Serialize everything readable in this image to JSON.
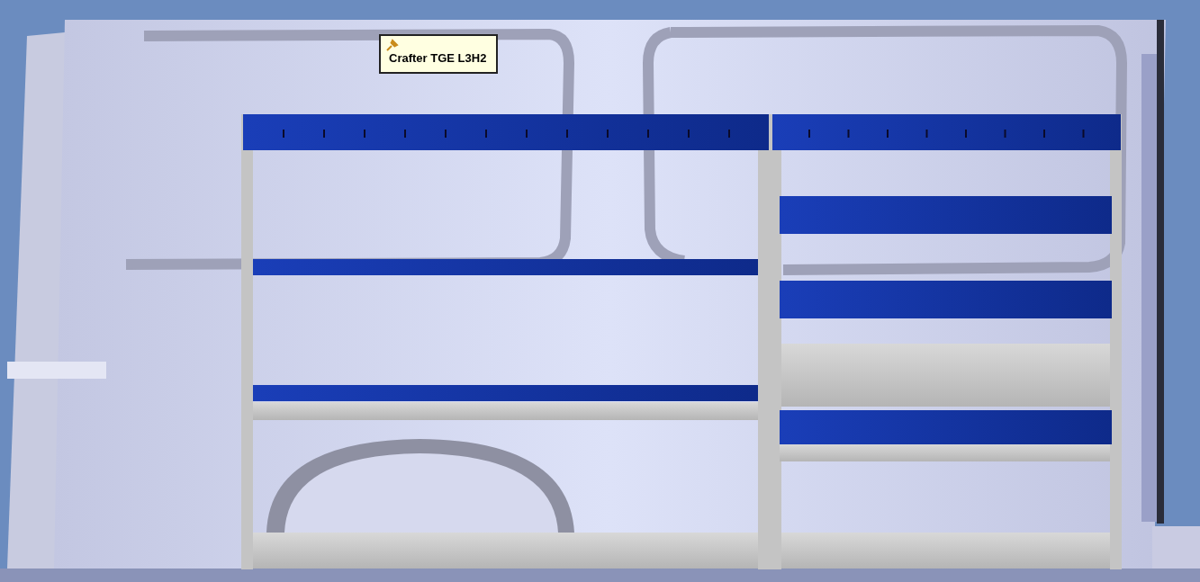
{
  "tooltip": {
    "label": "Crafter TGE L3H2"
  }
}
